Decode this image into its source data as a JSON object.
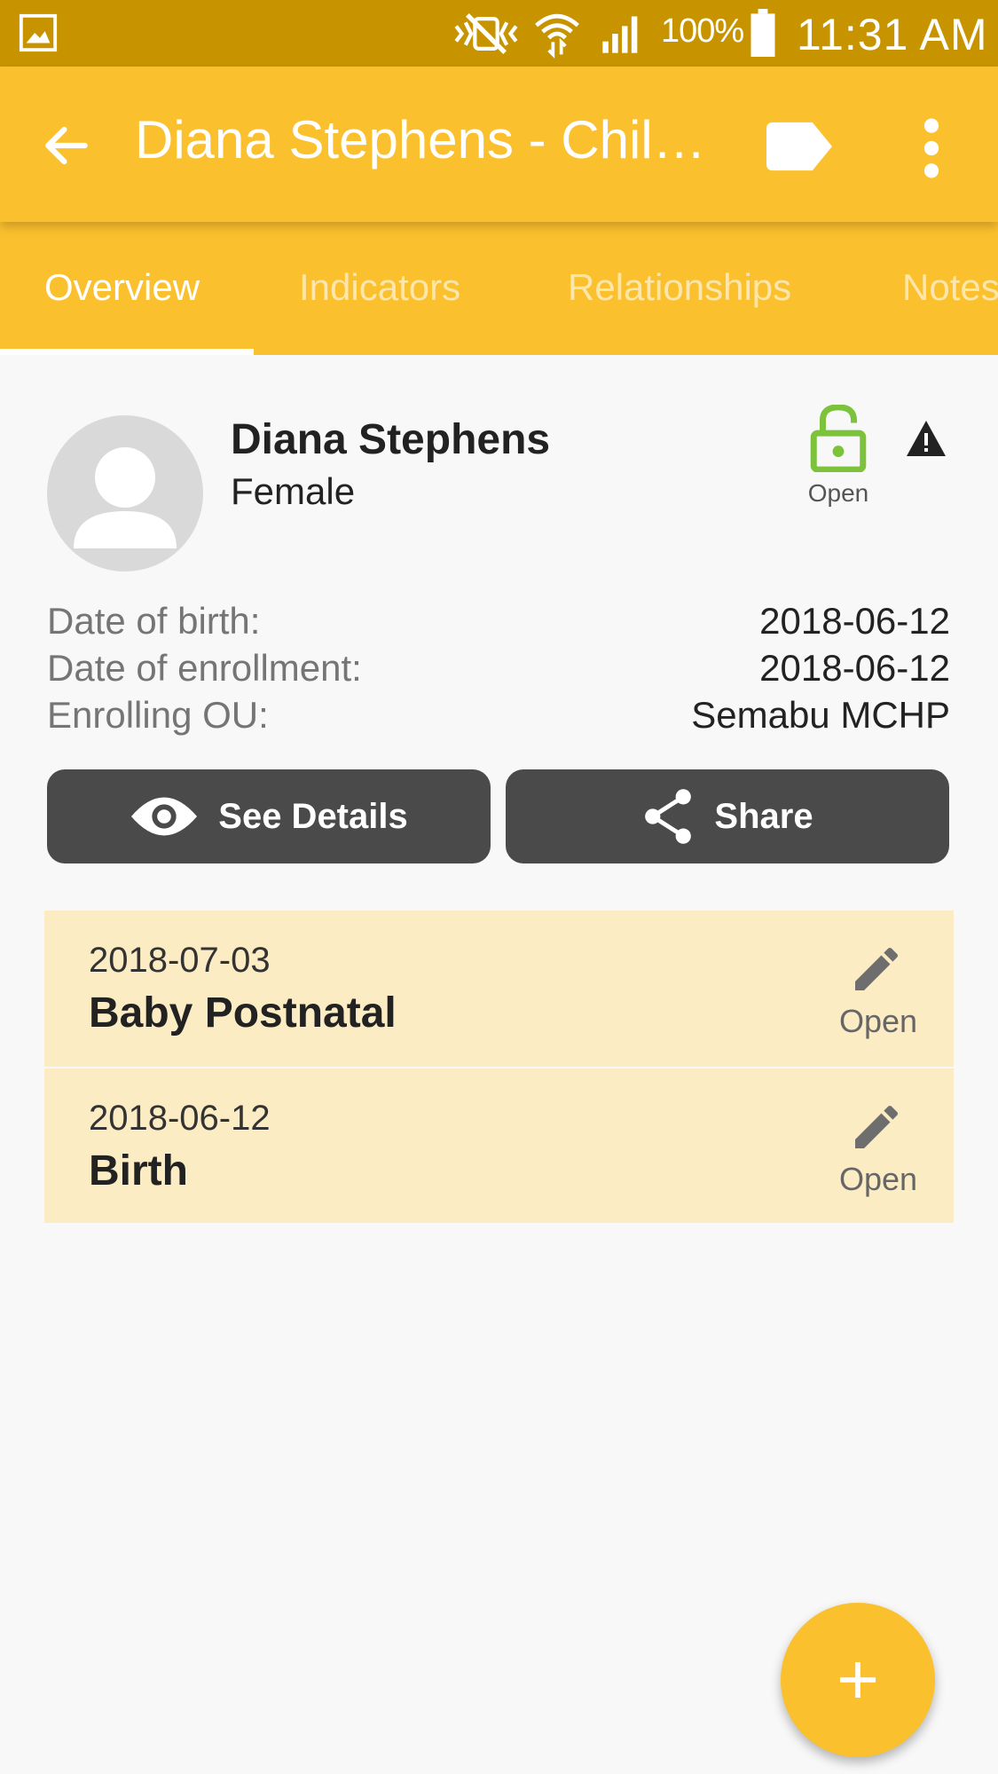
{
  "status_bar": {
    "battery": "100%",
    "time": "11:31 AM"
  },
  "app_bar": {
    "title": "Diana Stephens - Child Programme"
  },
  "tabs": [
    {
      "label": "Overview"
    },
    {
      "label": "Indicators"
    },
    {
      "label": "Relationships"
    },
    {
      "label": "Notes"
    }
  ],
  "profile": {
    "name": "Diana Stephens",
    "sex": "Female",
    "enrollment_status": "Open"
  },
  "details": [
    {
      "label": "Date of birth:",
      "value": "2018-06-12"
    },
    {
      "label": "Date of enrollment:",
      "value": "2018-06-12"
    },
    {
      "label": "Enrolling OU:",
      "value": "Semabu MCHP"
    }
  ],
  "actions": {
    "see_details": "See Details",
    "share": "Share"
  },
  "events": [
    {
      "date": "2018-07-03",
      "stage": "Baby Postnatal",
      "status": "Open"
    },
    {
      "date": "2018-06-12",
      "stage": "Birth",
      "status": "Open"
    }
  ],
  "colors": {
    "primary": "#fbc02d",
    "status_bar": "#c79400",
    "event_bg": "#fbecc3",
    "lock_green": "#7cc33b",
    "button_dark": "#4a4a4a"
  }
}
